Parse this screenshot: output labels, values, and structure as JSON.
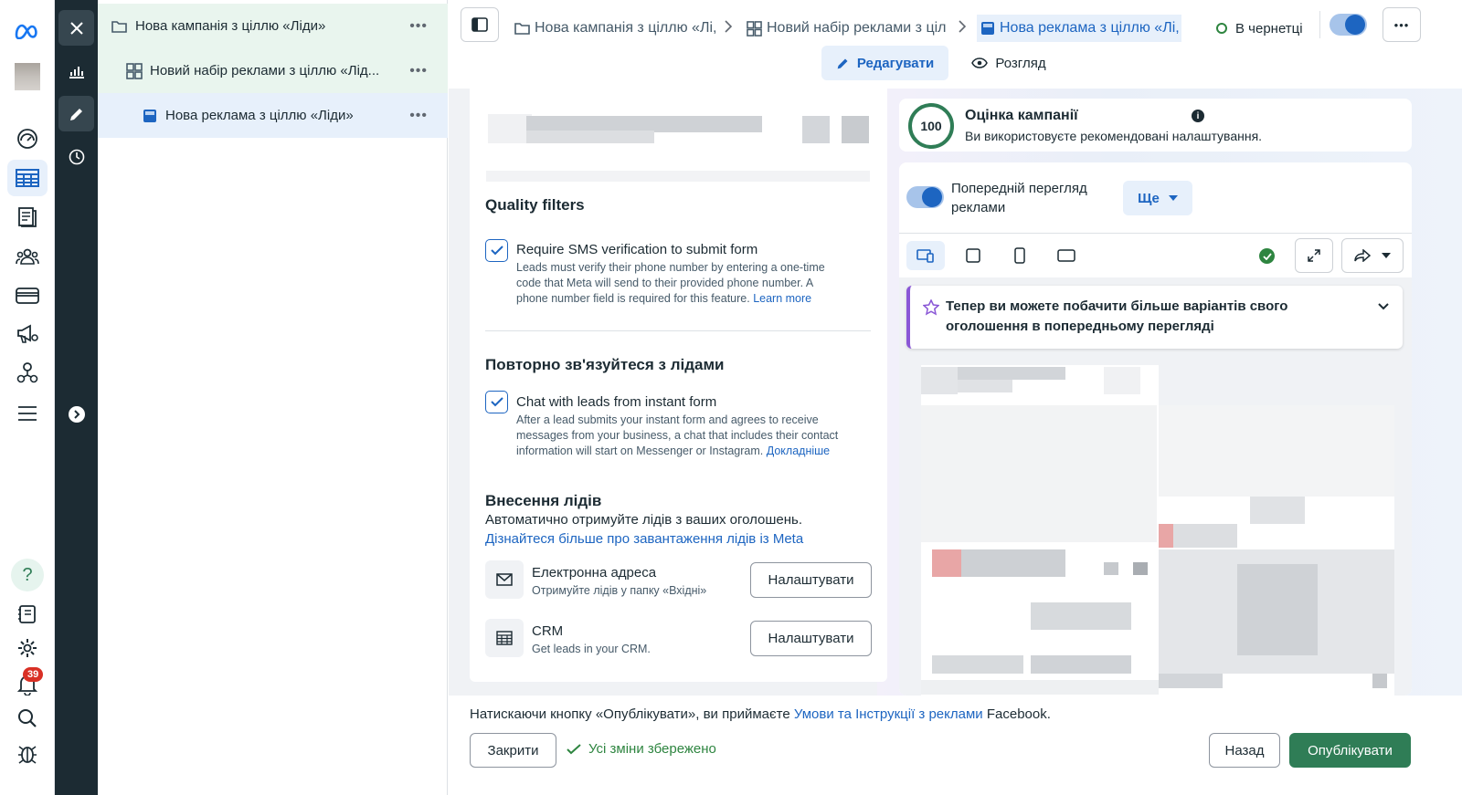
{
  "tree": {
    "campaign": "Нова кампанія з ціллю «Ліди»",
    "adset": "Новий набір реклами з ціллю «Лід...",
    "ad": "Нова реклама з ціллю «Ліди»",
    "more": "•••"
  },
  "rail": {
    "notifications_count": "39",
    "help": "?"
  },
  "breadcrumbs": {
    "campaign": "Нова кампанія з ціллю «Лі,",
    "adset": "Новий набір реклами з ціл",
    "ad": "Нова реклама з ціллю «Лі,",
    "status": "В чернетці"
  },
  "modes": {
    "edit": "Редагувати",
    "review": "Розгляд"
  },
  "form": {
    "quality_title": "Quality filters",
    "sms_label": "Require SMS verification to submit form",
    "sms_desc_1": "Leads must verify their phone number by entering a one-time",
    "sms_desc_2": "code that Meta will send to their provided phone number. A",
    "sms_desc_3": "phone number field is required for this feature.",
    "sms_link": "Learn more",
    "reconnect_title": "Повторно зв'язуйтеся з лідами",
    "chat_label": "Chat with leads from instant form",
    "chat_desc_1": "After a lead submits your instant form and agrees to receive",
    "chat_desc_2": "messages from your business, a chat that includes their contact",
    "chat_desc_3": "information will start on Messenger or Instagram.",
    "chat_link": "Докладніше",
    "leads_title": "Внесення лідів",
    "leads_sub": "Автоматично отримуйте лідів з ваших оголошень.",
    "leads_link": "Дізнайтеся більше про завантаження лідів із Meta",
    "email_title": "Електронна адреса",
    "email_sub": "Отримуйте лідів у папку «Вхідні»",
    "crm_title": "CRM",
    "crm_sub": "Get leads in your CRM.",
    "setup_button": "Налаштувати"
  },
  "score": {
    "value": "100",
    "progress": 1.0,
    "title": "Оцінка кампанії",
    "subtitle": "Ви використовуєте рекомендовані налаштування."
  },
  "preview": {
    "toggle_label_1": "Попередній перегляд",
    "toggle_label_2": "реклами",
    "more_button": "Ще",
    "banner_line1": "Тепер ви можете побачити більше варіантів свого",
    "banner_line2": "оголошення в попередньому перегляді"
  },
  "footer": {
    "terms_prefix": "Натискаючи кнопку «Опублікувати», ви приймаєте",
    "terms_link": "Умови та Інструкції з реклами",
    "terms_suffix": "Facebook.",
    "close_button": "Закрити",
    "saved_status": "Усі зміни збережено",
    "back_button": "Назад",
    "publish_button": "Опублікувати"
  },
  "colors": {
    "accent": "#1d65c1",
    "publish": "#2f7d56",
    "success": "#2e8540",
    "dark_rail": "#1c2b33"
  }
}
